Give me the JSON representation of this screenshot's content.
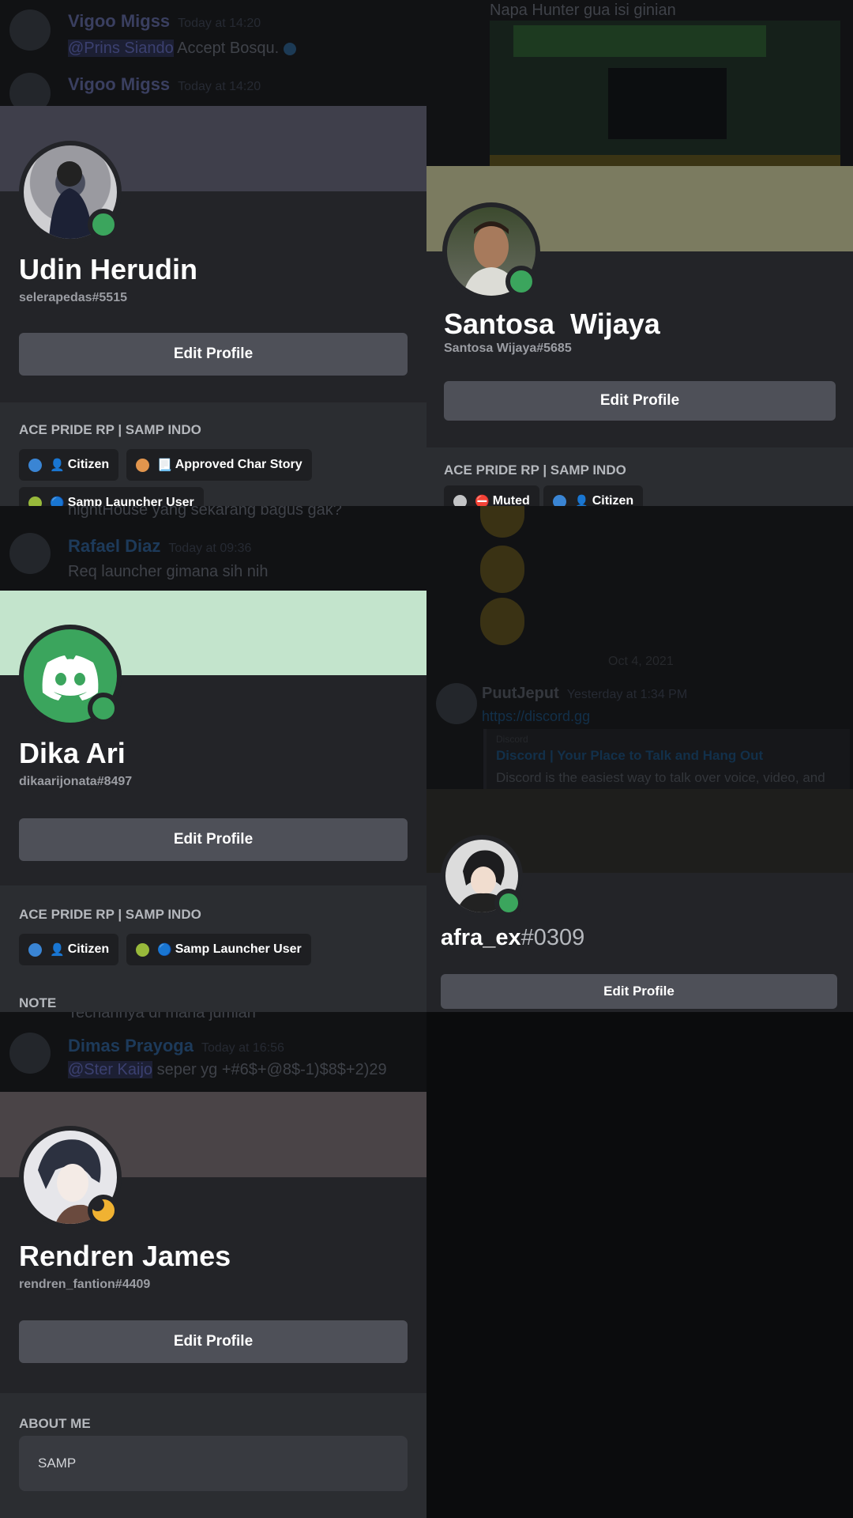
{
  "colors": {
    "online": "#3ba55d",
    "idle": "#f0b232",
    "button": "#4e5058",
    "role_blue": "#3a85d4",
    "role_orange": "#e1954d",
    "role_olive": "#98b93b",
    "role_grey": "#c3c4c6"
  },
  "bg_chat": {
    "top_left": [
      {
        "name": "Vigoo Migss",
        "time": "Today at 14:20",
        "mention": "@Prins Siando",
        "text": "Accept Bosqu."
      },
      {
        "name": "Vigoo Migss",
        "time": "Today at 14:20"
      }
    ],
    "top_right": {
      "text": "Napa Hunter gua isi ginian"
    },
    "mid_left": {
      "text_top": "nightHouse yang sekarang bagus gak?",
      "name": "Rafael Diaz",
      "time": "Today at 09:36",
      "text": "Req launcher gimana sih nih"
    },
    "mid_right": {
      "date": "Oct 4, 2021",
      "name": "PuutJeput",
      "time": "Yesterday at 1:34 PM",
      "link": "https://discord.gg",
      "embed_site": "Discord",
      "embed_title": "Discord | Your Place to Talk and Hang Out",
      "embed_desc": "Discord is the easiest way to talk over voice, video, and"
    },
    "low_left": {
      "text_top": "Techarinya di mana jumlah",
      "name": "Dimas Prayoga",
      "time": "Today at 16:56",
      "mention": "@Ster Kaijo",
      "text": "seper yg +#6$+@8$-1)$8$+2)29"
    }
  },
  "cards": [
    {
      "display_name": "Udin Herudin",
      "username": "selerapedas#5515",
      "edit_label": "Edit Profile",
      "server_name": "ACE PRIDE RP | SAMP INDO",
      "roles": [
        {
          "label": "Citizen",
          "emoji": "👤",
          "color": "#3a85d4"
        },
        {
          "label": "Approved Char Story",
          "emoji": "📃",
          "color": "#e1954d"
        },
        {
          "label": "Samp Launcher User",
          "emoji": "🔵",
          "color": "#98b93b"
        }
      ]
    },
    {
      "display_name": "Santosa  Wijaya",
      "username": "Santosa Wijaya#5685",
      "edit_label": "Edit Profile",
      "server_name": "ACE PRIDE RP | SAMP INDO",
      "roles": [
        {
          "label": "Muted",
          "emoji": "⛔",
          "color": "#c3c4c6"
        },
        {
          "label": "Citizen",
          "emoji": "👤",
          "color": "#3a85d4"
        }
      ]
    },
    {
      "display_name": "Dika Ari",
      "username": "dikaarijonata#8497",
      "edit_label": "Edit Profile",
      "server_name": "ACE PRIDE RP | SAMP INDO",
      "roles": [
        {
          "label": "Citizen",
          "emoji": "👤",
          "color": "#3a85d4"
        },
        {
          "label": "Samp Launcher User",
          "emoji": "🔵",
          "color": "#98b93b"
        }
      ],
      "note_title": "NOTE"
    },
    {
      "display_name": "afra_ex",
      "discriminator": "#0309",
      "edit_label": "Edit Profile"
    },
    {
      "display_name": "Rendren James",
      "username": "rendren_fantion#4409",
      "edit_label": "Edit Profile",
      "about_title": "ABOUT ME",
      "about_text": "SAMP"
    }
  ]
}
